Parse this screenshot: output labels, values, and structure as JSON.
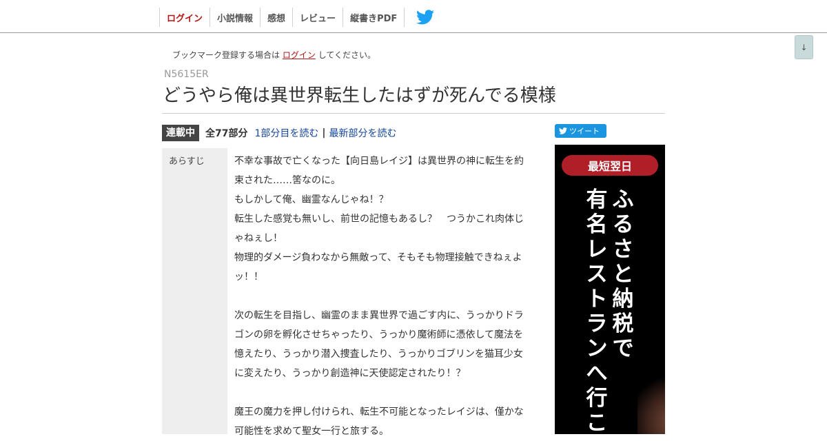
{
  "nav": {
    "items": [
      {
        "label": "ログイン",
        "name": "nav-login"
      },
      {
        "label": "小説情報",
        "name": "nav-novel-info"
      },
      {
        "label": "感想",
        "name": "nav-impressions"
      },
      {
        "label": "レビュー",
        "name": "nav-review"
      },
      {
        "label": "縦書きPDF",
        "name": "nav-vertical-pdf"
      }
    ],
    "twitter_icon": "twitter-bird-icon",
    "accent_color": "#b31414",
    "twitter_color": "#1da1f2"
  },
  "scroll_button": {
    "label": "↓"
  },
  "bookmark": {
    "prefix": "ブックマーク登録する場合は",
    "login_link": "ログイン",
    "suffix": "してください。"
  },
  "novel": {
    "ncode": "N5615ER",
    "title": "どうやら俺は異世界転生したはずが死んでる模様",
    "status": "連載中",
    "parts": "全77部分",
    "first_link": "1部分目を読む",
    "separator": "|",
    "latest_link": "最新部分を読む"
  },
  "tweet": {
    "label": "ツイート",
    "color": "#1b95e0"
  },
  "synopsis": {
    "label": "あらすじ",
    "lines": [
      "不幸な事故で亡くなった【向日島レイジ】は異世界の神に転生を約束された……筈なのに。",
      "もしかして俺、幽霊なんじゃね！？",
      "転生した感覚も無いし、前世の記憶もあるし？　つうかこれ肉体じゃねぇし！",
      "物理的ダメージ負わなから無敵って、そもそも物理接触できねぇよッ！！",
      "",
      "次の転生を目指し、幽霊のまま異世界で過ごす内に、うっかりドラゴンの卵を孵化させちゃったり、うっかり魔術師に憑依して魔法を憶えたり、うっかり潜入捜査したり、うっかりゴブリンを猫耳少女に変えたり、うっかり創造神に天使認定されたり！？",
      "",
      "魔王の魔力を押し付けられ、転生不可能となったレイジは、僅かな可能性を求めて聖女一行と旅する。"
    ]
  },
  "ad": {
    "pill": "最短翌日",
    "col1": "ふるさと納税で",
    "col2": "有名レストランへ行こう",
    "pill_color": "#b01e28"
  }
}
